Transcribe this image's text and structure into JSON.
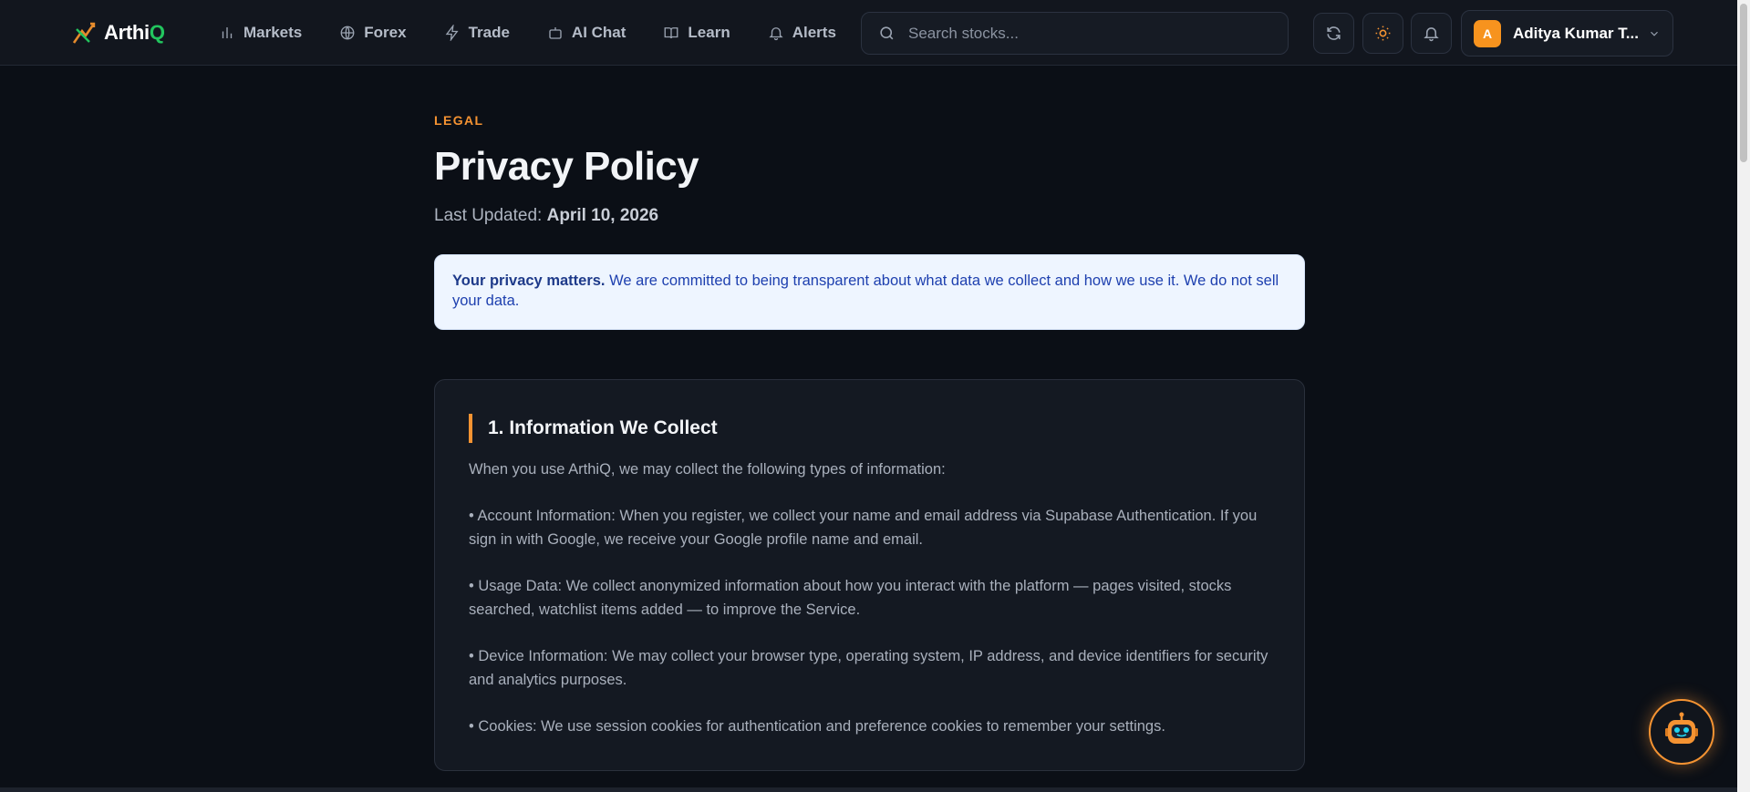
{
  "header": {
    "logo_text_main": "Arthi",
    "logo_text_accent": "Q",
    "nav": [
      {
        "label": "Markets",
        "icon": "bar-chart-icon"
      },
      {
        "label": "Forex",
        "icon": "globe-icon"
      },
      {
        "label": "Trade",
        "icon": "lightning-icon"
      },
      {
        "label": "AI Chat",
        "icon": "robot-icon"
      },
      {
        "label": "Learn",
        "icon": "book-icon"
      },
      {
        "label": "Alerts",
        "icon": "bell-icon"
      }
    ],
    "search_placeholder": "Search stocks...",
    "user": {
      "initial": "A",
      "name": "Aditya Kumar T..."
    }
  },
  "page": {
    "eyebrow": "LEGAL",
    "title": "Privacy Policy",
    "updated_label": "Last Updated: ",
    "updated_date": "April 10, 2026",
    "notice_bold": "Your privacy matters.",
    "notice_text": " We are committed to being transparent about what data we collect and how we use it. We do not sell your data."
  },
  "section1": {
    "title": "1. Information We Collect",
    "intro": "When you use ArthiQ, we may collect the following types of information:",
    "items": [
      "• Account Information: When you register, we collect your name and email address via Supabase Authentication. If you sign in with Google, we receive your Google profile name and email.",
      "• Usage Data: We collect anonymized information about how you interact with the platform — pages visited, stocks searched, watchlist items added — to improve the Service.",
      "• Device Information: We may collect your browser type, operating system, IP address, and device identifiers for security and analytics purposes.",
      "• Cookies: We use session cookies for authentication and preference cookies to remember your settings."
    ]
  },
  "colors": {
    "accent": "#f59332",
    "brand_green": "#22c55e",
    "background": "#0b0f16",
    "notice_bg": "#eef5ff",
    "notice_text": "#1e40af"
  }
}
